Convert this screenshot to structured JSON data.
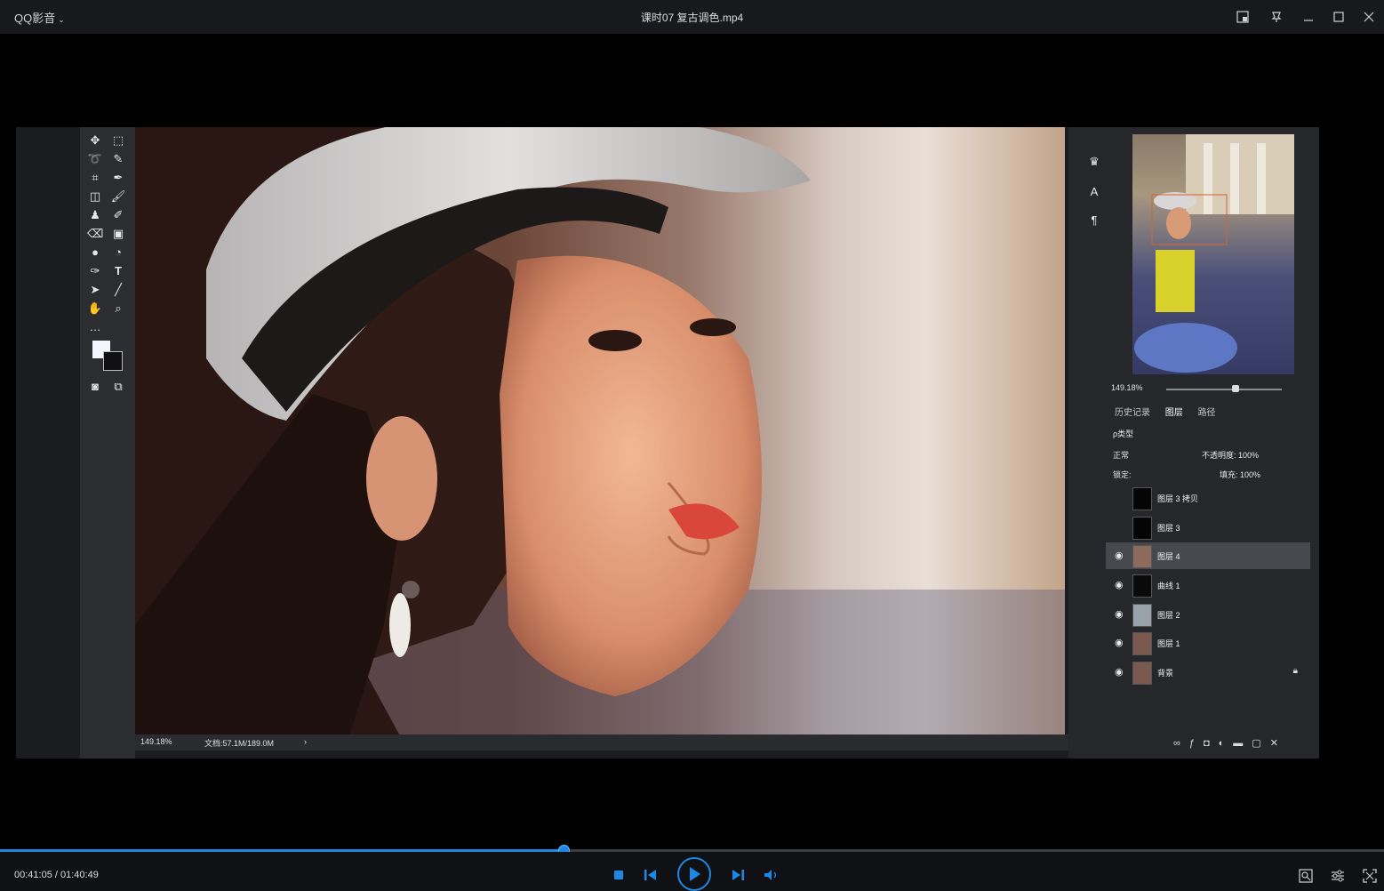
{
  "window": {
    "app_name": "QQ影音",
    "title": "课时07 复古调色.mp4"
  },
  "photoshop": {
    "status_zoom": "149.18%",
    "status_doc": "文档:57.1M/189.0M",
    "status_arrow": "›",
    "navigator_zoom": "149.18%",
    "tabs": [
      "历史记录",
      "图层",
      "路径"
    ],
    "filter_label": "ρ类型",
    "blend_mode": "正常",
    "opacity": "不透明度: 100%",
    "lock_label": "锁定:",
    "fill": "填充: 100%",
    "layers": [
      {
        "name": "图层 3 拷贝",
        "visible": false,
        "selected": false
      },
      {
        "name": "图层 3",
        "visible": false,
        "selected": false
      },
      {
        "name": "图层 4",
        "visible": true,
        "selected": true
      },
      {
        "name": "曲线 1",
        "visible": true,
        "selected": false
      },
      {
        "name": "图层 2",
        "visible": true,
        "selected": false
      },
      {
        "name": "图层 1",
        "visible": true,
        "selected": false
      },
      {
        "name": "背景",
        "visible": true,
        "selected": false
      }
    ],
    "tool_text_glyph": "T",
    "tool_more_glyph": "…"
  },
  "player": {
    "current_time": "00:41:05",
    "total_time": "01:40:49",
    "time_display": "00:41:05 / 01:40:49",
    "progress": 0.4074,
    "accent_color": "#1e88e5"
  }
}
